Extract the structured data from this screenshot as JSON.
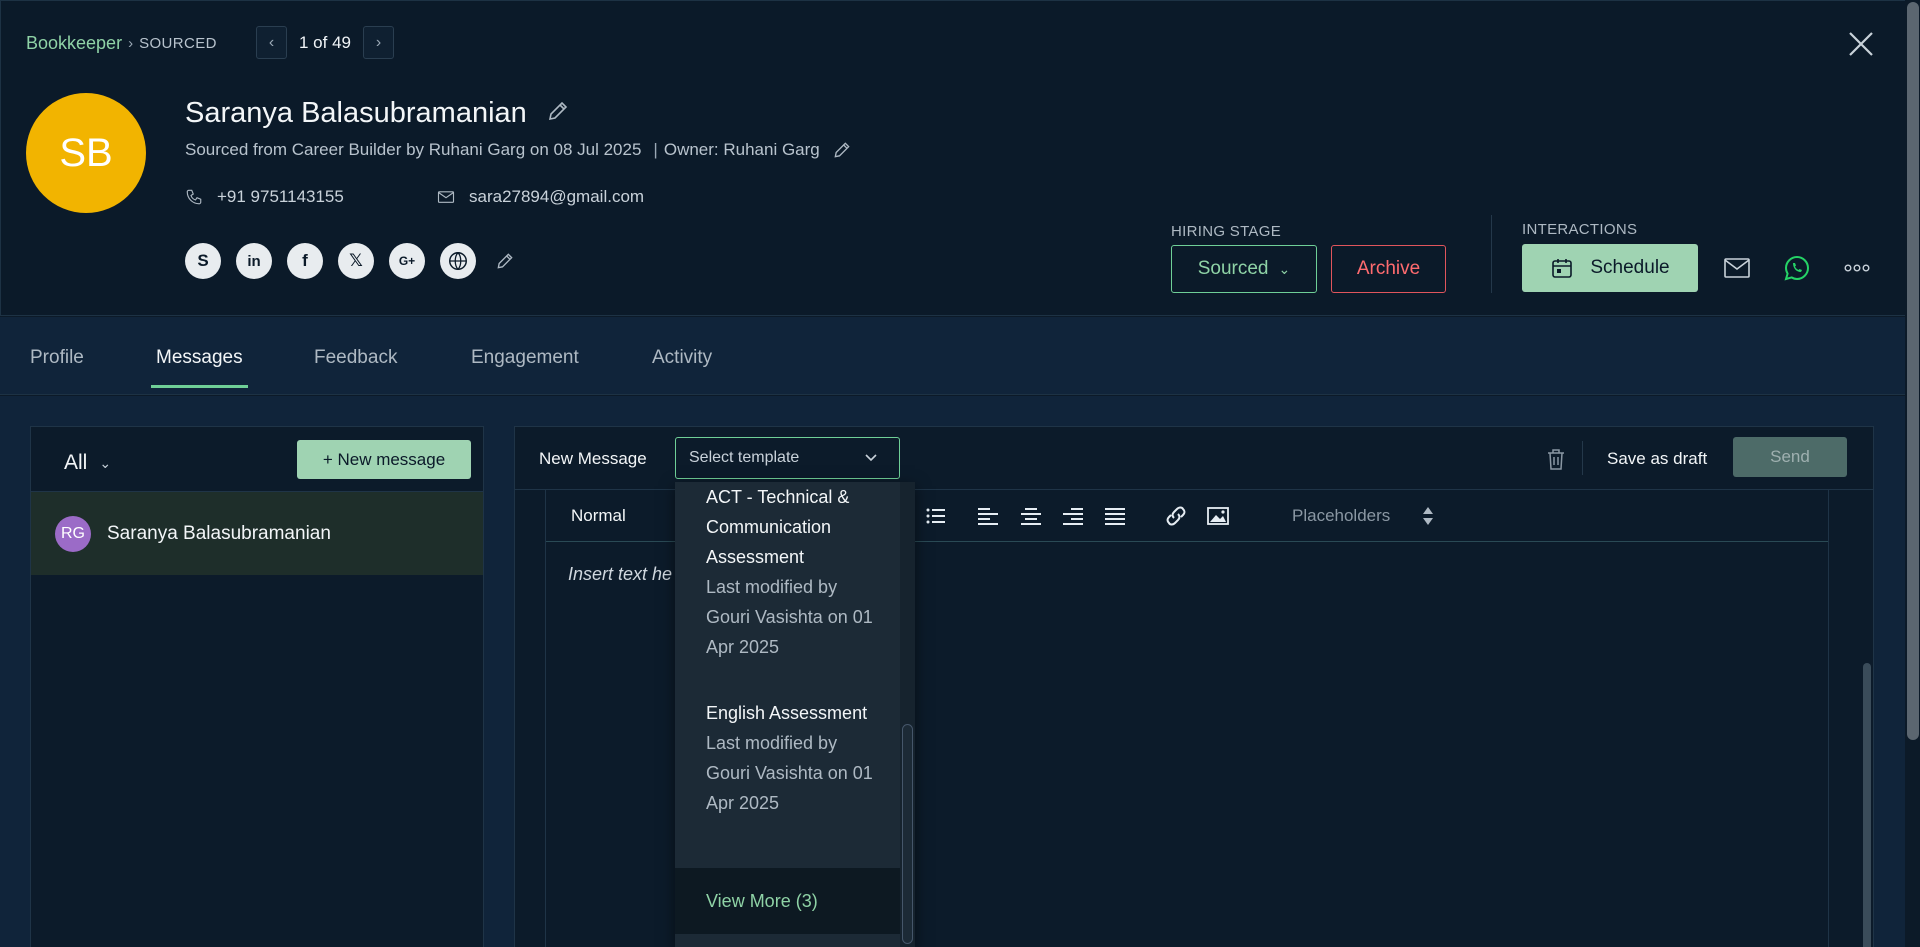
{
  "breadcrumb": {
    "job": "Bookkeeper",
    "stage": "SOURCED"
  },
  "pager": {
    "text": "1 of 49"
  },
  "candidate": {
    "initials": "SB",
    "name": "Saranya Balasubramanian",
    "sourced_text": "Sourced from Career Builder by Ruhani Garg on 08 Jul 2025",
    "owner_text": "Owner: Ruhani Garg",
    "phone": "+91 9751143155",
    "email": "sara27894@gmail.com",
    "avatar_color": "#f2b400"
  },
  "socials": [
    "skype-icon",
    "linkedin-icon",
    "facebook-icon",
    "x-icon",
    "google-plus-icon",
    "globe-icon"
  ],
  "hiring_stage": {
    "label": "HIRING STAGE",
    "value": "Sourced",
    "archive": "Archive"
  },
  "interactions": {
    "label": "INTERACTIONS",
    "schedule": "Schedule"
  },
  "tabs": [
    {
      "label": "Profile"
    },
    {
      "label": "Messages",
      "active": true
    },
    {
      "label": "Feedback"
    },
    {
      "label": "Engagement"
    },
    {
      "label": "Activity"
    }
  ],
  "messages": {
    "filter": "All",
    "new_message": "+ New message",
    "conversations": [
      {
        "initials": "RG",
        "name": "Saranya Balasubramanian"
      }
    ]
  },
  "composer": {
    "title": "New Message",
    "template_placeholder": "Select template",
    "save_draft": "Save as draft",
    "send": "Send",
    "format": "Normal",
    "placeholders": "Placeholders",
    "body_placeholder": "Insert text he"
  },
  "template_dropdown": {
    "items": [
      {
        "title": "ACT - Technical & Communication Assessment",
        "meta": "Last modified by Gouri Vasishta on 01 Apr 2025"
      },
      {
        "title": "English Assessment",
        "meta": "Last modified by Gouri Vasishta on 01 Apr 2025"
      }
    ],
    "view_more": "View More (3)"
  },
  "colors": {
    "accent": "#6fcf97",
    "button_bg": "#9fd3b2",
    "danger": "#e0555c",
    "background": "#0b1a29"
  }
}
